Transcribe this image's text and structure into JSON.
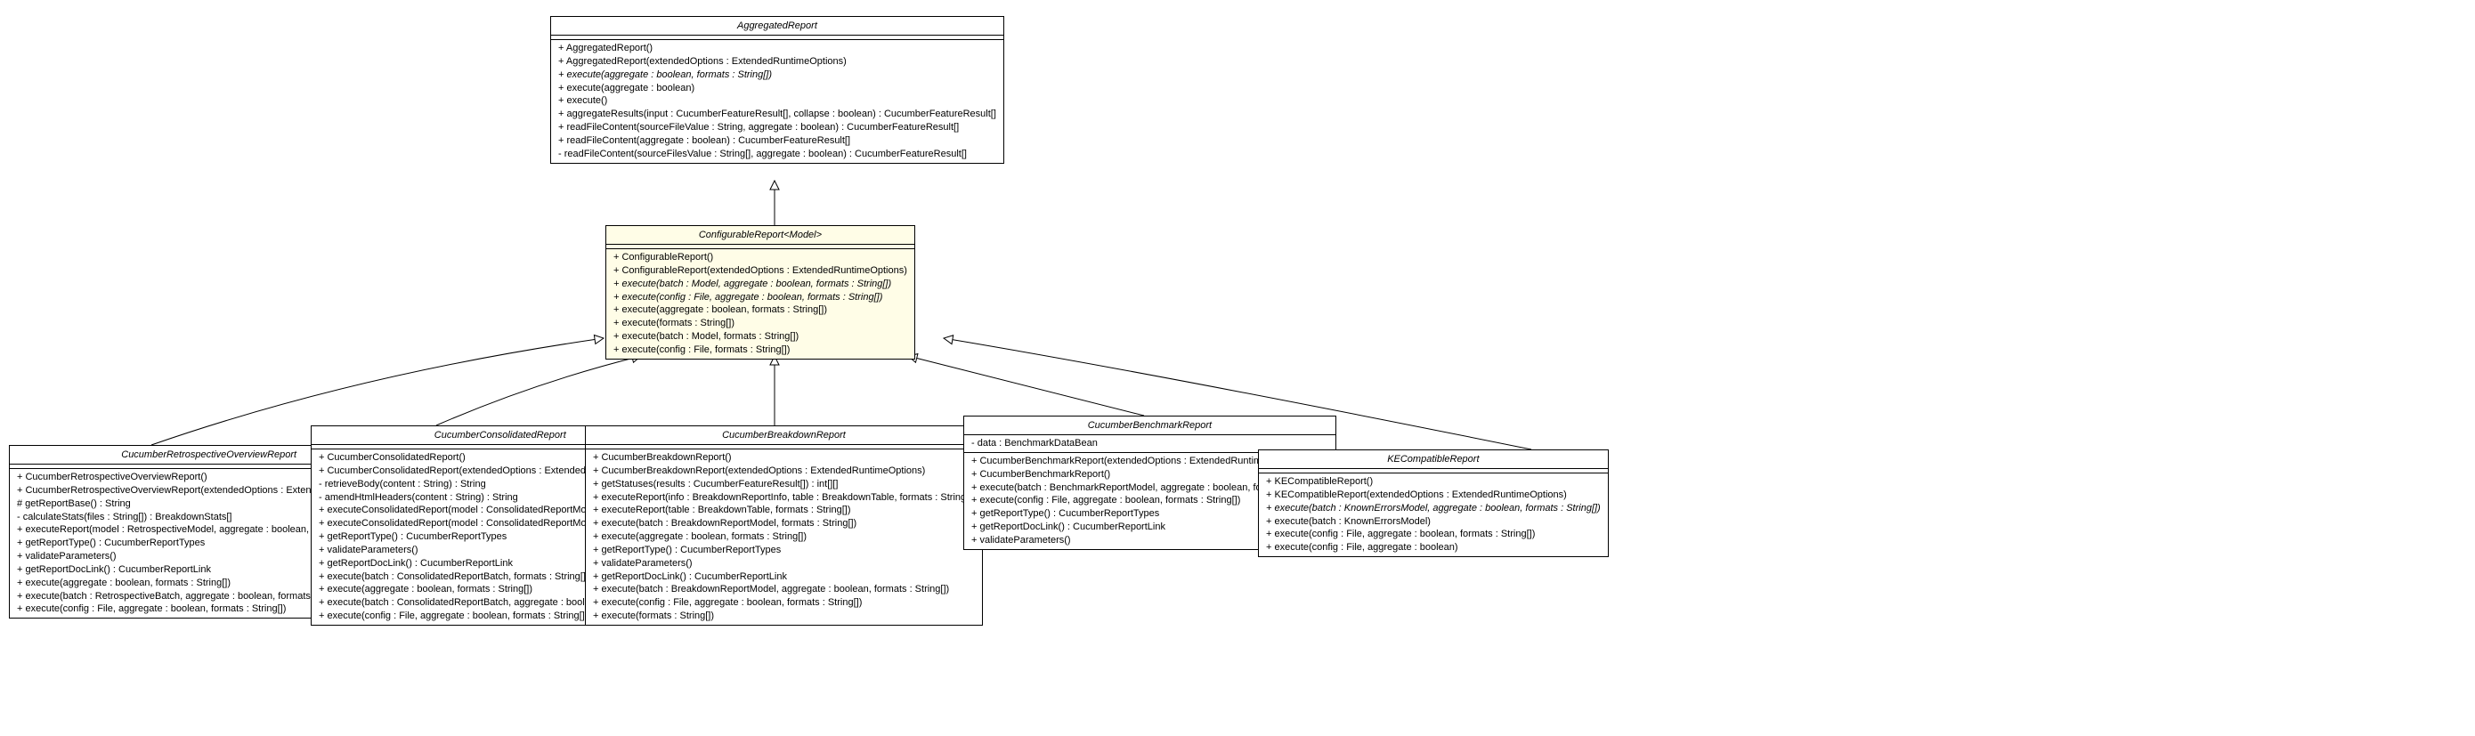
{
  "classes": {
    "aggregated": {
      "title": "AggregatedReport",
      "attrs": [],
      "methods": [
        {
          "text": "+ AggregatedReport()"
        },
        {
          "text": "+ AggregatedReport(extendedOptions : ExtendedRuntimeOptions)"
        },
        {
          "text": "+ execute(aggregate : boolean, formats : String[])",
          "italic": true
        },
        {
          "text": "+ execute(aggregate : boolean)"
        },
        {
          "text": "+ execute()"
        },
        {
          "text": "+ aggregateResults(input : CucumberFeatureResult[], collapse : boolean) : CucumberFeatureResult[]"
        },
        {
          "text": "+ readFileContent(sourceFileValue : String, aggregate : boolean) : CucumberFeatureResult[]"
        },
        {
          "text": "+ readFileContent(aggregate : boolean) : CucumberFeatureResult[]"
        },
        {
          "text": "- readFileContent(sourceFilesValue : String[], aggregate : boolean) : CucumberFeatureResult[]"
        }
      ]
    },
    "configurable": {
      "title": "ConfigurableReport<Model>",
      "attrs": [],
      "methods": [
        {
          "text": "+ ConfigurableReport()"
        },
        {
          "text": "+ ConfigurableReport(extendedOptions : ExtendedRuntimeOptions)"
        },
        {
          "text": "+ execute(batch : Model, aggregate : boolean, formats : String[])",
          "italic": true
        },
        {
          "text": "+ execute(config : File, aggregate : boolean, formats : String[])",
          "italic": true
        },
        {
          "text": "+ execute(aggregate : boolean, formats : String[])"
        },
        {
          "text": "+ execute(formats : String[])"
        },
        {
          "text": "+ execute(batch : Model, formats : String[])"
        },
        {
          "text": "+ execute(config : File, formats : String[])"
        }
      ]
    },
    "retrospective": {
      "title": "CucumberRetrospectiveOverviewReport",
      "attrs": [],
      "methods": [
        {
          "text": "+ CucumberRetrospectiveOverviewReport()"
        },
        {
          "text": "+ CucumberRetrospectiveOverviewReport(extendedOptions : ExtendedRuntimeOptions)"
        },
        {
          "text": "# getReportBase() : String"
        },
        {
          "text": "- calculateStats(files : String[]) : BreakdownStats[]"
        },
        {
          "text": "+ executeReport(model : RetrospectiveModel, aggregate : boolean, formats : String[])"
        },
        {
          "text": "+ getReportType() : CucumberReportTypes"
        },
        {
          "text": "+ validateParameters()"
        },
        {
          "text": "+ getReportDocLink() : CucumberReportLink"
        },
        {
          "text": "+ execute(aggregate : boolean, formats : String[])"
        },
        {
          "text": "+ execute(batch : RetrospectiveBatch, aggregate : boolean, formats : String[])"
        },
        {
          "text": "+ execute(config : File, aggregate : boolean, formats : String[])"
        }
      ]
    },
    "consolidated": {
      "title": "CucumberConsolidatedReport",
      "attrs": [],
      "methods": [
        {
          "text": "+ CucumberConsolidatedReport()"
        },
        {
          "text": "+ CucumberConsolidatedReport(extendedOptions : ExtendedRuntimeOptions)"
        },
        {
          "text": "- retrieveBody(content : String) : String"
        },
        {
          "text": "- amendHtmlHeaders(content : String) : String"
        },
        {
          "text": "+ executeConsolidatedReport(model : ConsolidatedReportModel, formats : String[])"
        },
        {
          "text": "+ executeConsolidatedReport(model : ConsolidatedReportModel)"
        },
        {
          "text": "+ getReportType() : CucumberReportTypes"
        },
        {
          "text": "+ validateParameters()"
        },
        {
          "text": "+ getReportDocLink() : CucumberReportLink"
        },
        {
          "text": "+ execute(batch : ConsolidatedReportBatch, formats : String[])"
        },
        {
          "text": "+ execute(aggregate : boolean, formats : String[])"
        },
        {
          "text": "+ execute(batch : ConsolidatedReportBatch, aggregate : boolean, formats : String[])"
        },
        {
          "text": "+ execute(config : File, aggregate : boolean, formats : String[])"
        }
      ]
    },
    "breakdown": {
      "title": "CucumberBreakdownReport",
      "attrs": [],
      "methods": [
        {
          "text": "+ CucumberBreakdownReport()"
        },
        {
          "text": "+ CucumberBreakdownReport(extendedOptions : ExtendedRuntimeOptions)"
        },
        {
          "text": "+ getStatuses(results : CucumberFeatureResult[]) : int[][]"
        },
        {
          "text": "+ executeReport(info : BreakdownReportInfo, table : BreakdownTable, formats : String[])"
        },
        {
          "text": "+ executeReport(table : BreakdownTable, formats : String[])"
        },
        {
          "text": "+ execute(batch : BreakdownReportModel, formats : String[])"
        },
        {
          "text": "+ execute(aggregate : boolean, formats : String[])"
        },
        {
          "text": "+ getReportType() : CucumberReportTypes"
        },
        {
          "text": "+ validateParameters()"
        },
        {
          "text": "+ getReportDocLink() : CucumberReportLink"
        },
        {
          "text": "+ execute(batch : BreakdownReportModel, aggregate : boolean, formats : String[])"
        },
        {
          "text": "+ execute(config : File, aggregate : boolean, formats : String[])"
        },
        {
          "text": "+ execute(formats : String[])"
        }
      ]
    },
    "benchmark": {
      "title": "CucumberBenchmarkReport",
      "attrs": [
        {
          "text": "- data : BenchmarkDataBean"
        }
      ],
      "methods": [
        {
          "text": "+ CucumberBenchmarkReport(extendedOptions : ExtendedRuntimeOptions)"
        },
        {
          "text": "+ CucumberBenchmarkReport()"
        },
        {
          "text": "+ execute(batch : BenchmarkReportModel, aggregate : boolean, formats : String[])"
        },
        {
          "text": "+ execute(config : File, aggregate : boolean, formats : String[])"
        },
        {
          "text": "+ getReportType() : CucumberReportTypes"
        },
        {
          "text": "+ getReportDocLink() : CucumberReportLink"
        },
        {
          "text": "+ validateParameters()"
        }
      ]
    },
    "kecompatible": {
      "title": "KECompatibleReport",
      "attrs": [],
      "methods": [
        {
          "text": "+ KECompatibleReport()"
        },
        {
          "text": "+ KECompatibleReport(extendedOptions : ExtendedRuntimeOptions)"
        },
        {
          "text": "+ execute(batch : KnownErrorsModel, aggregate : boolean, formats : String[])",
          "italic": true
        },
        {
          "text": "+ execute(batch : KnownErrorsModel)"
        },
        {
          "text": "+ execute(config : File, aggregate : boolean, formats : String[])"
        },
        {
          "text": "+ execute(config : File, aggregate : boolean)"
        }
      ]
    }
  }
}
